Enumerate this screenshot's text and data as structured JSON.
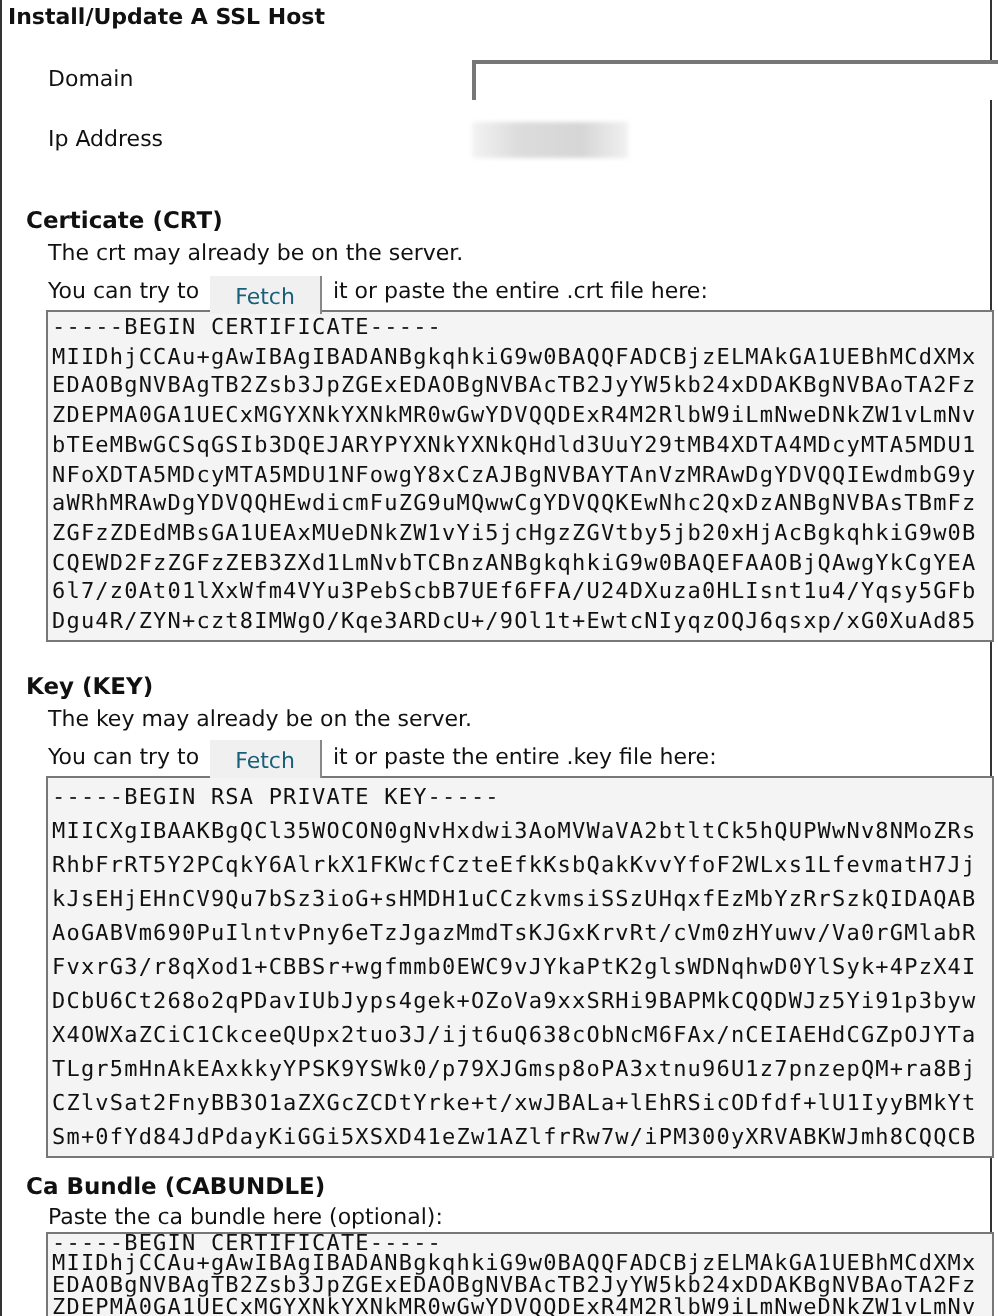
{
  "title": "Install/Update A SSL Host",
  "fields": [
    {
      "label": "Domain",
      "kind": "input"
    },
    {
      "label": "Ip Address",
      "kind": "redacted"
    }
  ],
  "sections": [
    {
      "title": "Certicate (CRT)",
      "note": "The crt may already be on the server.",
      "fetch": {
        "before": "You can try to",
        "button": "Fetch",
        "after": "it or paste the entire .crt file here:"
      },
      "content": [
        "-----BEGIN CERTIFICATE-----",
        "MIIDhjCCAu+gAwIBAgIBADANBgkqhkiG9w0BAQQFADCBjzELMAkGA1UEBhMCdXMx",
        "EDAOBgNVBAgTB2Zsb3JpZGExEDAOBgNVBAcTB2JyYW5kb24xDDAKBgNVBAoTA2Fz",
        "ZDEPMA0GA1UECxMGYXNkYXNkMR0wGwYDVQQDExR4M2RlbW9iLmNweDNkZW1vLmNv",
        "bTEeMBwGCSqGSIb3DQEJARYPYXNkYXNkQHdld3UuY29tMB4XDTA4MDcyMTA5MDU1",
        "NFoXDTA5MDcyMTA5MDU1NFowgY8xCzAJBgNVBAYTAnVzMRAwDgYDVQQIEwdmbG9y",
        "aWRhMRAwDgYDVQQHEwdicmFuZG9uMQwwCgYDVQQKEwNhc2QxDzANBgNVBAsTBmFz",
        "ZGFzZDEdMBsGA1UEAxMUeDNkZW1vYi5jcHgzZGVtby5jb20xHjAcBgkqhkiG9w0B",
        "CQEWD2FzZGFzZEB3ZXd1LmNvbTCBnzANBgkqhkiG9w0BAQEFAAOBjQAwgYkCgYEA",
        "6l7/z0At01lXxWfm4VYu3PebScbB7UEf6FFA/U24DXuza0HLIsnt1u4/Yqsy5GFb",
        "Dgu4R/ZYN+czt8IMWgO/Kqe3ARDcU+/9Ol1t+EwtcNIyqzOQJ6qsxp/xG0XuAd85"
      ]
    },
    {
      "title": "Key (KEY)",
      "note": "The key may already be on the server.",
      "fetch": {
        "before": "You can try to",
        "button": "Fetch",
        "after": "it or paste the entire .key file here:"
      },
      "content": [
        "-----BEGIN RSA PRIVATE KEY-----",
        "MIICXgIBAAKBgQCl35WOCON0gNvHxdwi3AoMVWaVA2btltCk5hQUPWwNv8NMoZRs",
        "RhbFrRT5Y2PCqkY6AlrkX1FKWcfCzteEfkKsbQakKvvYfoF2WLxs1LfevmatH7Jj",
        "kJsEHjEHnCV9Qu7bSz3ioG+sHMDH1uCCzkvmsiSSzUHqxfEzMbYzRrSzkQIDAQAB",
        "AoGABVm690PuIlntvPny6eTzJgazMmdTsKJGxKrvRt/cVm0zHYuwv/Va0rGMlabR",
        "FvxrG3/r8qXod1+CBBSr+wgfmmb0EWC9vJYkaPtK2glsWDNqhwD0YlSyk+4PzX4I",
        "DCbU6Ct268o2qPDavIUbJyps4gek+OZoVa9xxSRHi9BAPMkCQQDWJz5Yi91p3byw",
        "X4OWXaZCiC1CkceeQUpx2tuo3J/ijt6uQ638cObNcM6FAx/nCEIAEHdCGZpOJYTa",
        "TLgr5mHnAkEAxkkyYPSK9YSWk0/p79XJGmsp8oPA3xtnu96U1z7pnzepQM+ra8Bj",
        "CZlvSat2FnyBB3O1aZXGcZCDtYrke+t/xwJBALa+lEhRSicODfdf+lU1IyyBMkYt",
        "Sm+0fYd84JdPdayKiGGi5XSXD41eZw1AZlfrRw7w/iPM300yXRVABKWJmh8CQQCB"
      ]
    },
    {
      "title": "Ca Bundle (CABUNDLE)",
      "note": "Paste the ca bundle here (optional):",
      "content": [
        "-----BEGIN CERTIFICATE-----",
        "MIIDhjCCAu+gAwIBAgIBADANBgkqhkiG9w0BAQQFADCBjzELMAkGA1UEBhMCdXMx",
        "EDAOBgNVBAgTB2Zsb3JpZGExEDAOBgNVBAcTB2JyYW5kb24xDDAKBgNVBAoTA2Fz",
        "ZDEPMA0GA1UECxMGYXNkYXNkMR0wGwYDVQQDExR4M2RlbW9iLmNweDNkZW1vLmNv"
      ]
    }
  ]
}
